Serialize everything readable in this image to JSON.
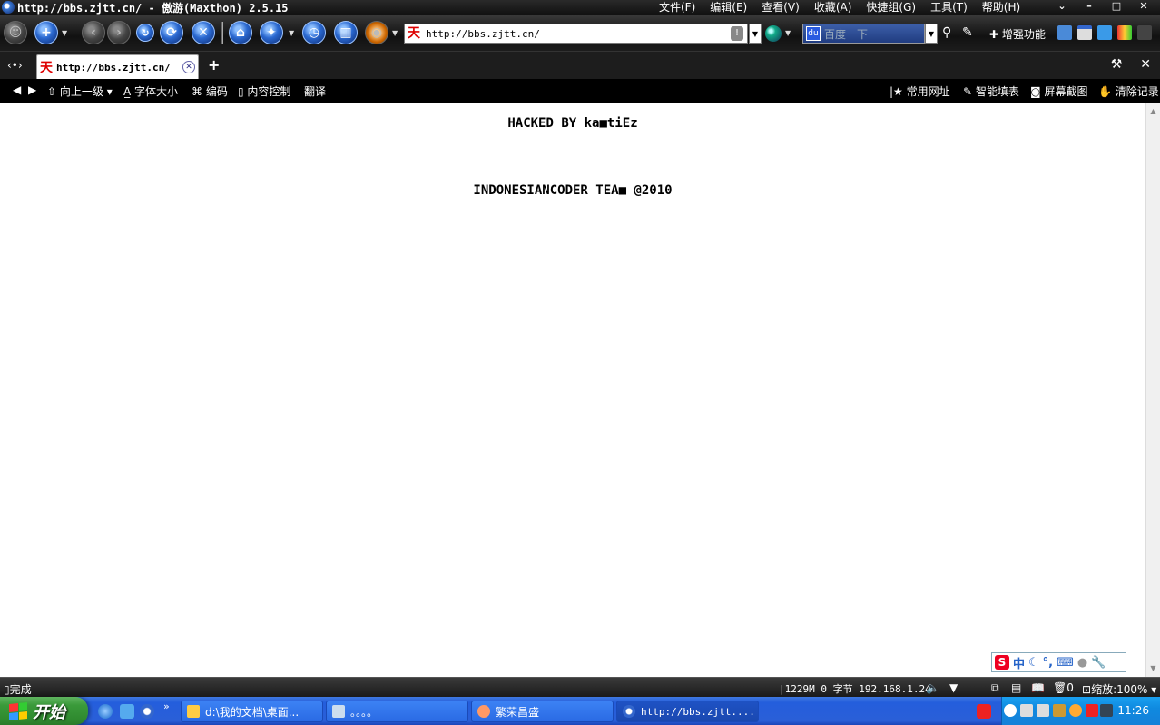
{
  "window": {
    "title": "http://bbs.zjtt.cn/ - 傲游(Maxthon) 2.5.15",
    "menu": [
      "文件(F)",
      "编辑(E)",
      "查看(V)",
      "收藏(A)",
      "快捷组(G)",
      "工具(T)",
      "帮助(H)"
    ]
  },
  "toolbar": {
    "address": "http://bbs.zjtt.cn/",
    "search_placeholder": "百度一下",
    "enhance_label": "增强功能"
  },
  "tab": {
    "label": "http://bbs.zjtt.cn/",
    "favicon": "天"
  },
  "bar2": {
    "up_level": "向上一级",
    "font_size": "字体大小",
    "encoding": "编码",
    "content_control": "内容控制",
    "translate": "翻译",
    "favorites": "常用网址",
    "autofill": "智能填表",
    "screenshot": "屏幕截图",
    "clear_history": "清除记录"
  },
  "page": {
    "line1": "HACKED BY ka■tiEz",
    "line2": "INDONESIANCODER TEA■ @2010"
  },
  "ime": {
    "mode": "中"
  },
  "status": {
    "text": "完成",
    "memory": "1229M 0 字节 192.168.1.24",
    "tab_count": "0",
    "zoom": "缩放:100%"
  },
  "taskbar": {
    "start": "开始",
    "tasks": [
      {
        "label": "d:\\我的文档\\桌面..."
      },
      {
        "label": "。。。。"
      },
      {
        "label": "繁荣昌盛"
      },
      {
        "label": "http://bbs.zjtt...."
      }
    ],
    "clock": "11:26"
  }
}
